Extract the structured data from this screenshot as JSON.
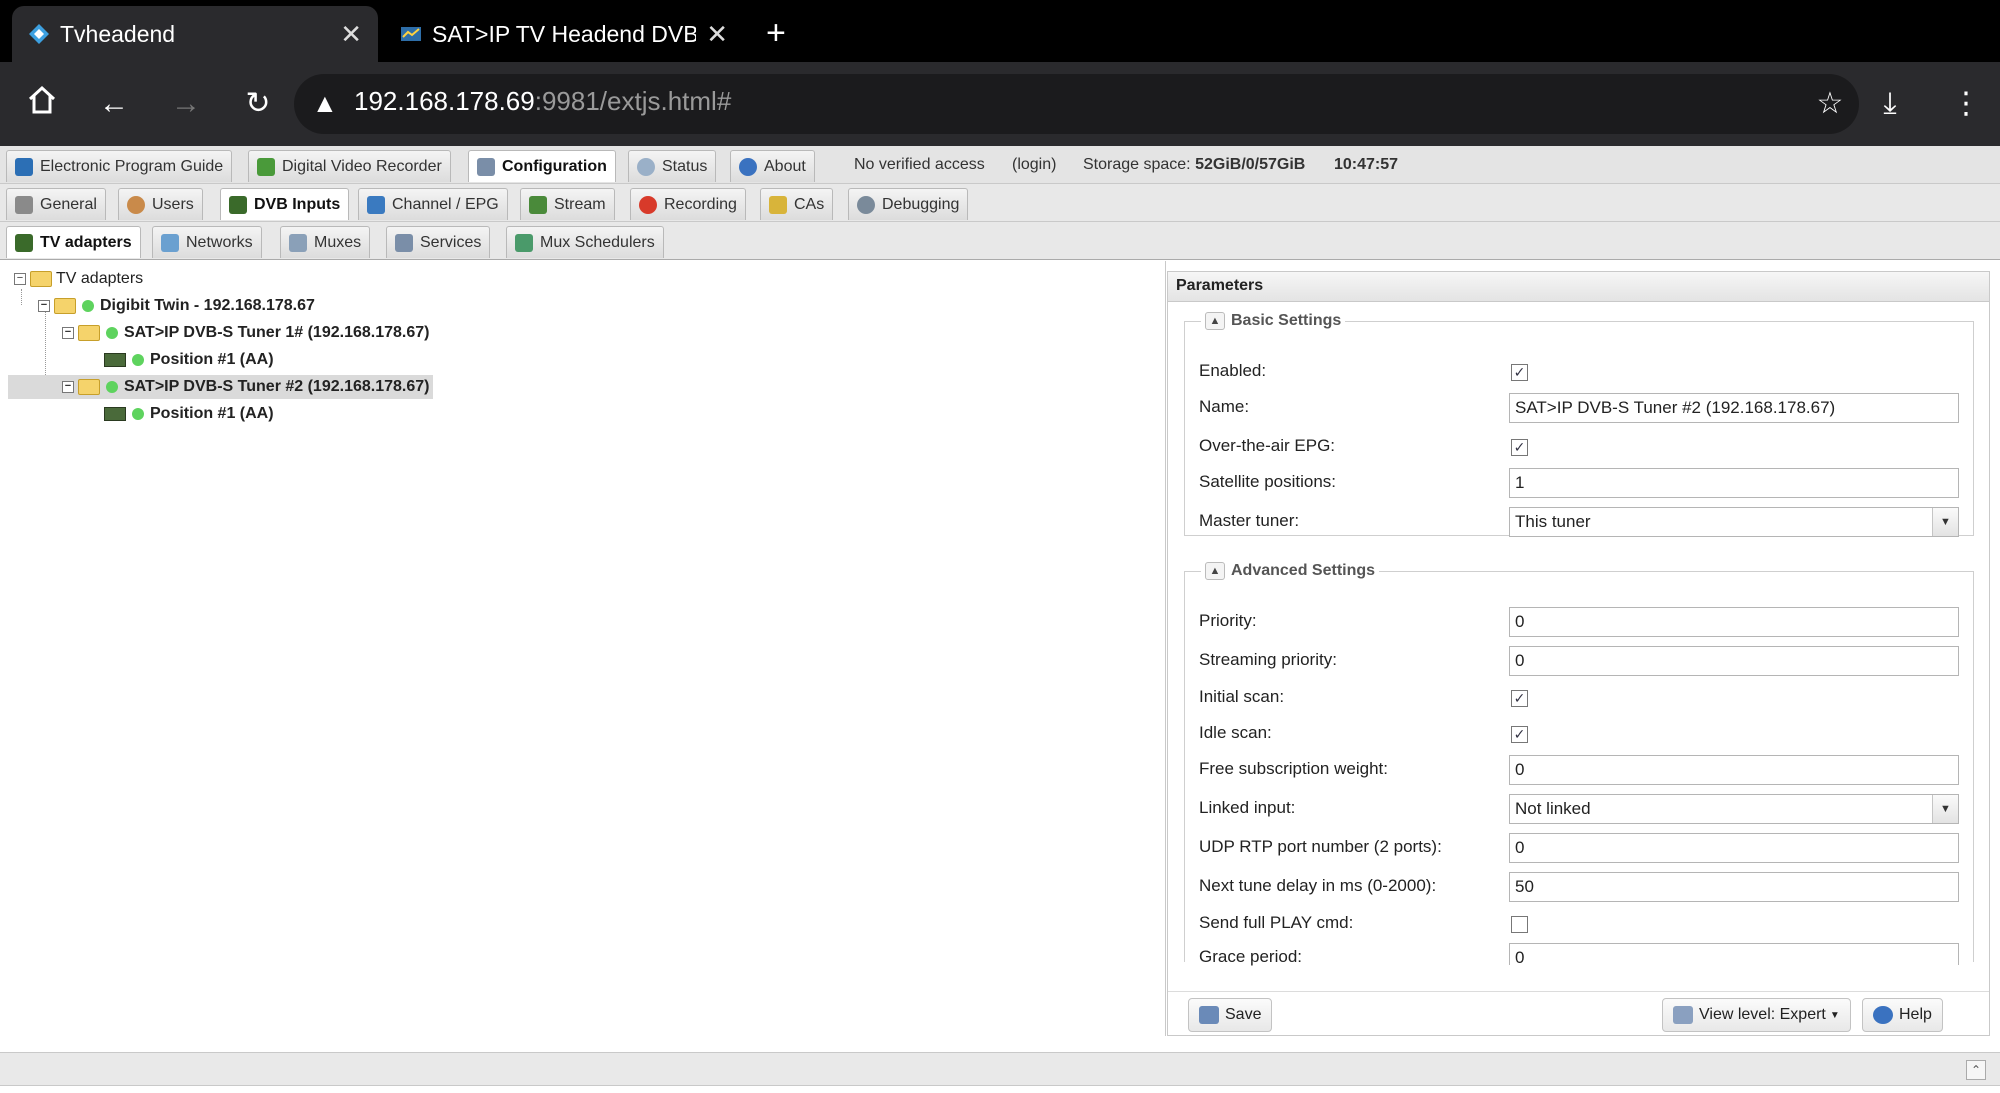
{
  "browser": {
    "tabs": [
      {
        "title": "Tvheadend",
        "active": true
      },
      {
        "title": "SAT>IP TV Headend DVB-",
        "active": false
      }
    ],
    "url_host": "192.168.178.69",
    "url_path": ":9981/extjs.html#"
  },
  "header": {
    "tabs": [
      "Electronic Program Guide",
      "Digital Video Recorder",
      "Configuration",
      "Status",
      "About"
    ],
    "selected_tab": "Configuration",
    "access": "No verified access",
    "login": "(login)",
    "storage_label": "Storage space:",
    "storage_value": "52GiB/0/57GiB",
    "time": "10:47:57"
  },
  "config_tabs": [
    "General",
    "Users",
    "DVB Inputs",
    "Channel / EPG",
    "Stream",
    "Recording",
    "CAs",
    "Debugging"
  ],
  "selected_config_tab": "DVB Inputs",
  "dvb_tabs": [
    "TV adapters",
    "Networks",
    "Muxes",
    "Services",
    "Mux Schedulers"
  ],
  "selected_dvb_tab": "TV adapters",
  "tree": {
    "root": "TV adapters",
    "device": "Digibit Twin - 192.168.178.67",
    "tuner1": "SAT>IP DVB-S Tuner 1# (192.168.178.67)",
    "tuner1_position": "Position #1 (AA)",
    "tuner2": "SAT>IP DVB-S Tuner #2 (192.168.178.67)",
    "tuner2_position": "Position #1 (AA)"
  },
  "params": {
    "title": "Parameters",
    "basic_title": "Basic Settings",
    "advanced_title": "Advanced Settings",
    "enabled_label": "Enabled:",
    "enabled": true,
    "name_label": "Name:",
    "name_value": "SAT>IP DVB-S Tuner #2 (192.168.178.67)",
    "ota_epg_label": "Over-the-air EPG:",
    "ota_epg": true,
    "sat_positions_label": "Satellite positions:",
    "sat_positions_value": "1",
    "master_tuner_label": "Master tuner:",
    "master_tuner_value": "This tuner",
    "priority_label": "Priority:",
    "priority_value": "0",
    "streaming_priority_label": "Streaming priority:",
    "streaming_priority_value": "0",
    "initial_scan_label": "Initial scan:",
    "initial_scan": true,
    "idle_scan_label": "Idle scan:",
    "idle_scan": true,
    "free_sub_label": "Free subscription weight:",
    "free_sub_value": "0",
    "linked_input_label": "Linked input:",
    "linked_input_value": "Not linked",
    "udp_label": "UDP RTP port number (2 ports):",
    "udp_value": "0",
    "tune_delay_label": "Next tune delay in ms (0-2000):",
    "tune_delay_value": "50",
    "full_play_label": "Send full PLAY cmd:",
    "full_play": false,
    "grace_label": "Grace period:",
    "grace_value": "0"
  },
  "footer": {
    "save": "Save",
    "view_level": "View level: Expert",
    "help": "Help"
  }
}
